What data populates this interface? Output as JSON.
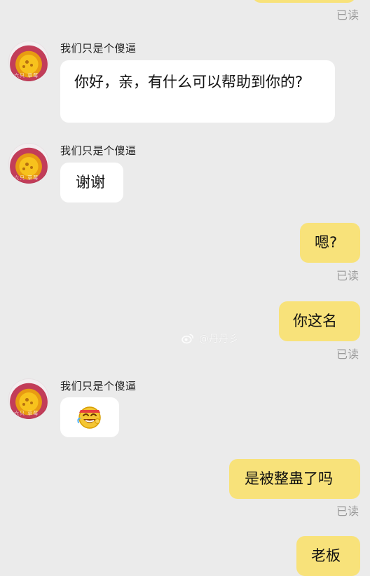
{
  "chat": {
    "read_receipt": "已读",
    "sender_name": "我们只是个傻逼",
    "messages": [
      {
        "side": "incoming",
        "sender": "我们只是个傻逼",
        "text": "你好，亲，有什么可以帮助到你的?"
      },
      {
        "side": "incoming",
        "sender": "我们只是个傻逼",
        "text": "谢谢"
      },
      {
        "side": "outgoing",
        "text": "嗯?",
        "read": "已读"
      },
      {
        "side": "outgoing",
        "text": "你这名",
        "read": "已读"
      },
      {
        "side": "incoming",
        "sender": "我们只是个傻逼",
        "text": "",
        "emoji": "laughing-tears-emoji"
      },
      {
        "side": "outgoing",
        "text": "是被整蛊了吗",
        "read": "已读"
      },
      {
        "side": "outgoing",
        "text": "老板"
      }
    ]
  },
  "watermark": {
    "text": "@丹丹彡",
    "icon": "weibo-logo-icon"
  },
  "colors": {
    "background": "#ebebeb",
    "incoming_bubble": "#ffffff",
    "outgoing_bubble": "#f8e27a",
    "read_receipt": "#9b9b9b"
  }
}
